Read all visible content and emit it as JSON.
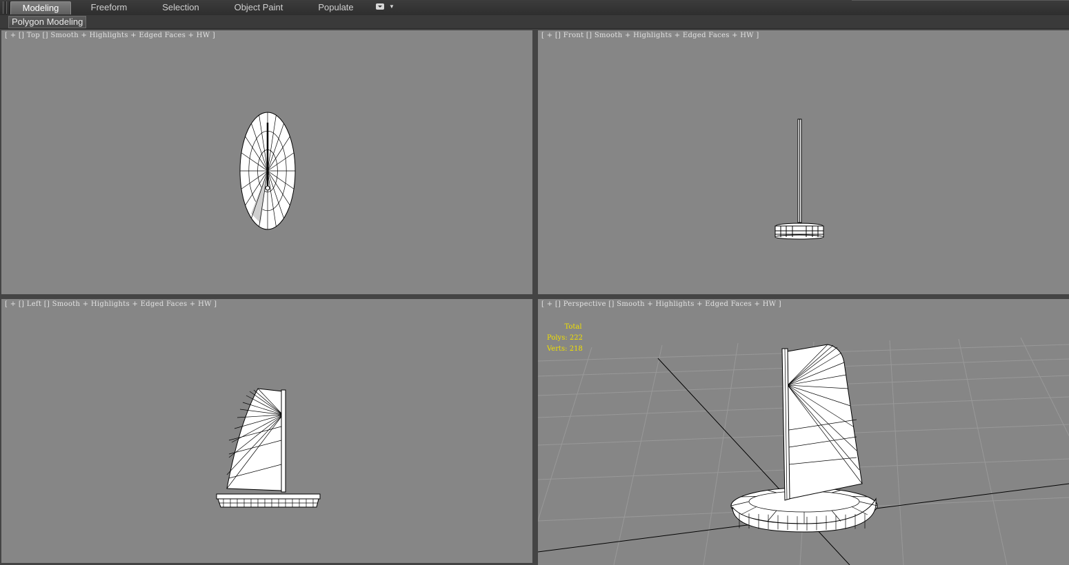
{
  "ribbon": {
    "tabs": [
      {
        "label": "Modeling",
        "active": true
      },
      {
        "label": "Freeform",
        "active": false
      },
      {
        "label": "Selection",
        "active": false
      },
      {
        "label": "Object Paint",
        "active": false
      },
      {
        "label": "Populate",
        "active": false
      }
    ],
    "options_icon": "dropdown-box-icon",
    "panel_label": "Polygon Modeling"
  },
  "viewports": {
    "top": {
      "plus": "+",
      "view": "Top",
      "shading": "Smooth + Highlights + Edged Faces + HW"
    },
    "front": {
      "plus": "+",
      "view": "Front",
      "shading": "Smooth + Highlights + Edged Faces + HW"
    },
    "left": {
      "plus": "+",
      "view": "Left",
      "shading": "Smooth + Highlights + Edged Faces + HW"
    },
    "perspective": {
      "plus": "+",
      "view": "Perspective",
      "shading": "Smooth + Highlights + Edged Faces + HW"
    }
  },
  "stats": {
    "header": "Total",
    "polys_label": "Polys:",
    "polys_value": "222",
    "verts_label": "Verts:",
    "verts_value": "218"
  },
  "colors": {
    "viewport_bg": "#868686",
    "stats_text": "#f0e000",
    "model_fill": "#ffffff",
    "wire": "#000000"
  }
}
